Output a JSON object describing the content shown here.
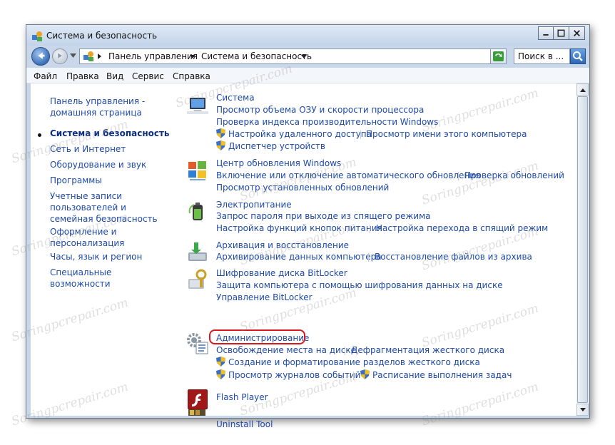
{
  "window": {
    "title": "Система и безопасность"
  },
  "address": {
    "crumbs": [
      "Панель управления",
      "Система и безопасность"
    ],
    "search_placeholder": "Поиск в ..."
  },
  "menu": [
    "Файл",
    "Правка",
    "Вид",
    "Сервис",
    "Справка"
  ],
  "sidebar": {
    "items": [
      {
        "label": "Панель управления - домашняя страница"
      },
      {
        "label": "Система и безопасность",
        "current": true
      },
      {
        "label": "Сеть и Интернет"
      },
      {
        "label": "Оборудование и звук"
      },
      {
        "label": "Программы"
      },
      {
        "label": "Учетные записи пользователей и семейная безопасность"
      },
      {
        "label": "Оформление и персонализация"
      },
      {
        "label": "Часы, язык и регион"
      },
      {
        "label": "Специальные возможности"
      }
    ]
  },
  "categories": [
    {
      "title": "Система",
      "icon": "computer-icon",
      "links": [
        "Просмотр объема ОЗУ и скорости процессора",
        "Проверка индекса производительности Windows",
        "Настройка удаленного доступа",
        "Просмотр имени этого компьютера",
        "Диспетчер устройств"
      ]
    },
    {
      "title": "Центр обновления Windows",
      "icon": "windows-update-icon",
      "links": [
        "Включение или отключение автоматического обновления",
        "Проверка обновлений",
        "Просмотр установленных обновлений"
      ]
    },
    {
      "title": "Электропитание",
      "icon": "battery-icon",
      "links": [
        "Запрос пароля при выходе из спящего режима",
        "Настройка функций кнопок питания",
        "Настройка перехода в спящий режим"
      ]
    },
    {
      "title": "Архивация и восстановление",
      "icon": "backup-icon",
      "links": [
        "Архивирование данных компьютера",
        "Восстановление файлов из архива"
      ]
    },
    {
      "title": "Шифрование диска BitLocker",
      "icon": "bitlocker-icon",
      "links": [
        "Защита компьютера с помощью шифрования данных на диске",
        "Управление BitLocker"
      ]
    },
    {
      "title": "Администрирование",
      "icon": "admin-tools-icon",
      "links": [
        "Освобождение места на диске",
        "Дефрагментация жесткого диска",
        "Создание и форматирование разделов жесткого диска",
        "Просмотр журналов событий",
        "Расписание выполнения задач"
      ]
    },
    {
      "title": "Flash Player",
      "icon": "flash-icon",
      "links": []
    },
    {
      "title": "Uninstall Tool",
      "icon": "uninstall-tool-icon",
      "links": []
    }
  ],
  "watermark": "Soringpcrepair.com",
  "colors": {
    "link": "#1e4aa8",
    "highlight": "#d7191e",
    "window_frame": "#c8d7ea"
  }
}
